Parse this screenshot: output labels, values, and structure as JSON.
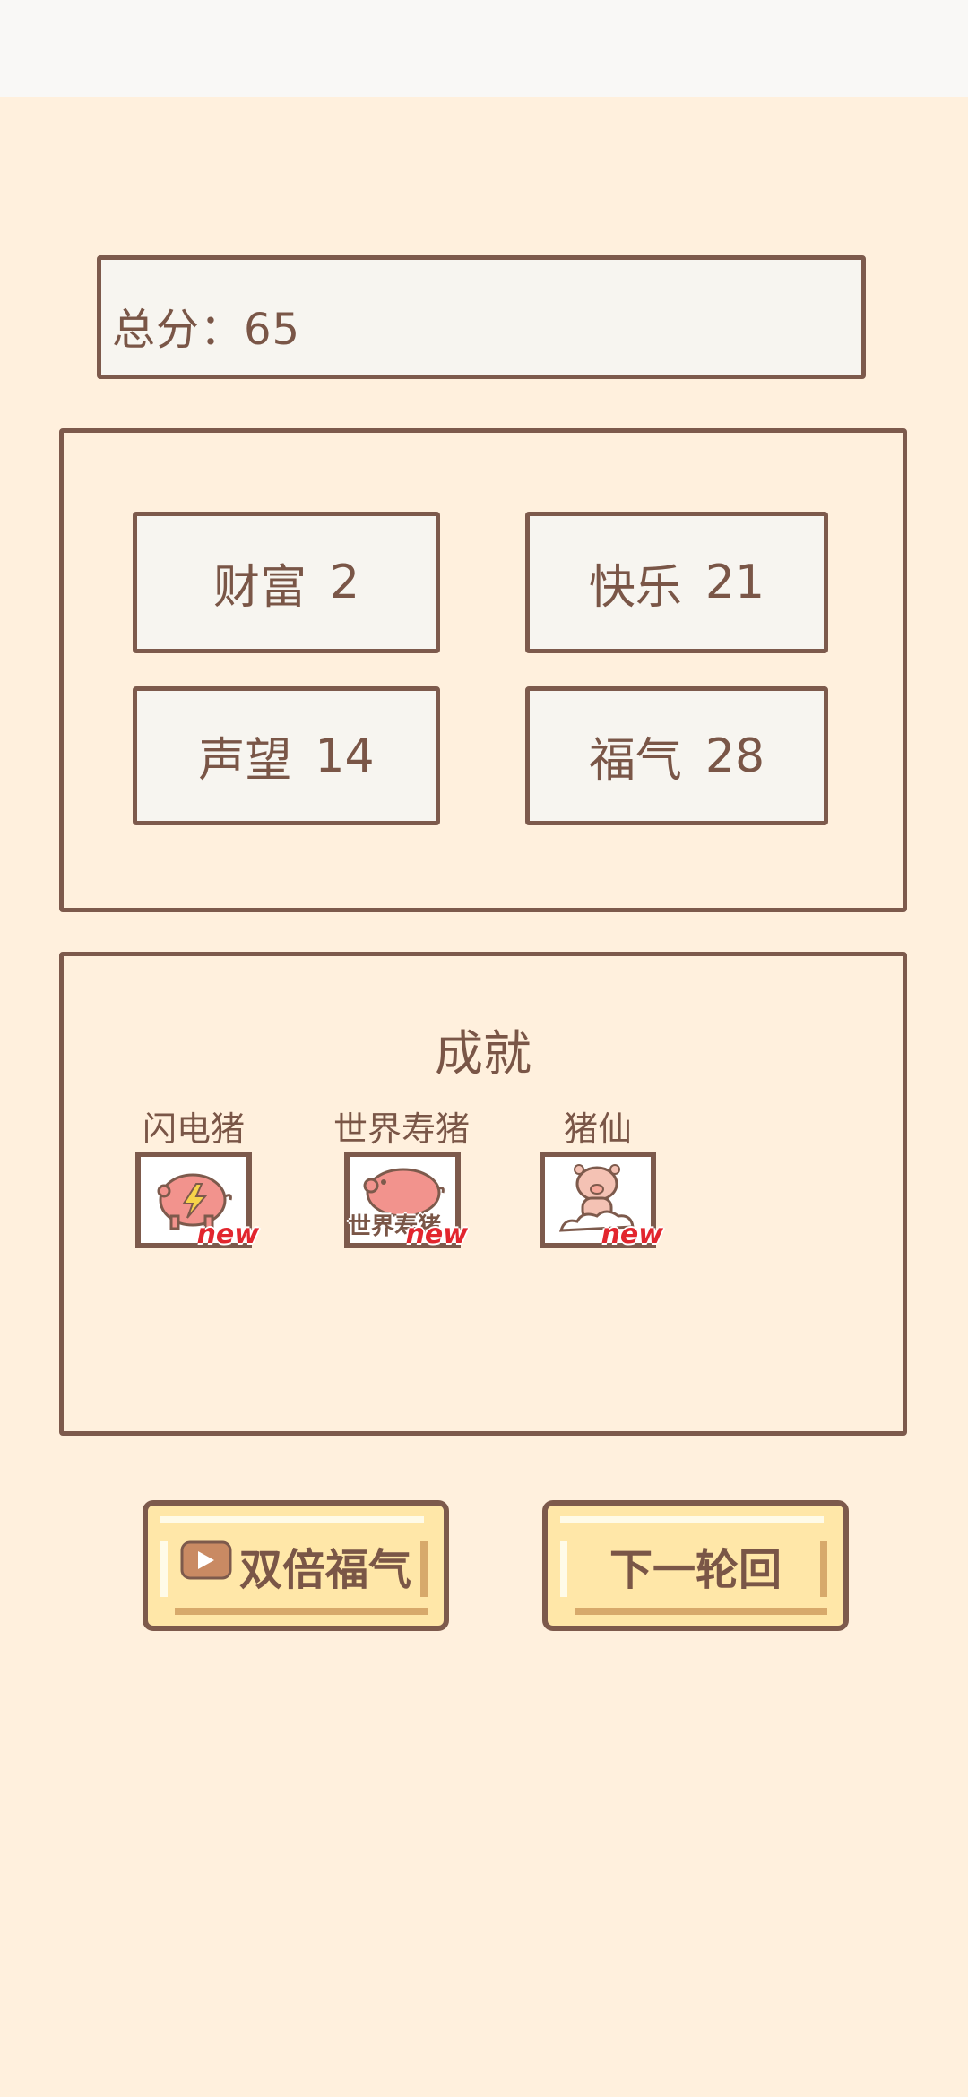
{
  "score": {
    "label": "总分：65"
  },
  "stats": [
    {
      "label": "财富",
      "value": "2"
    },
    {
      "label": "快乐",
      "value": "21"
    },
    {
      "label": "声望",
      "value": "14"
    },
    {
      "label": "福气",
      "value": "28"
    }
  ],
  "achievements": {
    "title": "成就",
    "items": [
      {
        "name": "闪电猪",
        "tag": "new"
      },
      {
        "name": "世界寿猪",
        "tag": "new",
        "overlay": "世界寿猪"
      },
      {
        "name": "猪仙",
        "tag": "new"
      }
    ]
  },
  "buttons": {
    "double": "双倍福气",
    "next": "下一轮回"
  },
  "colors": {
    "background": "#fff0dd",
    "border": "#7d5a4c",
    "button": "#ffe7a8",
    "new_tag": "#e2262e"
  }
}
